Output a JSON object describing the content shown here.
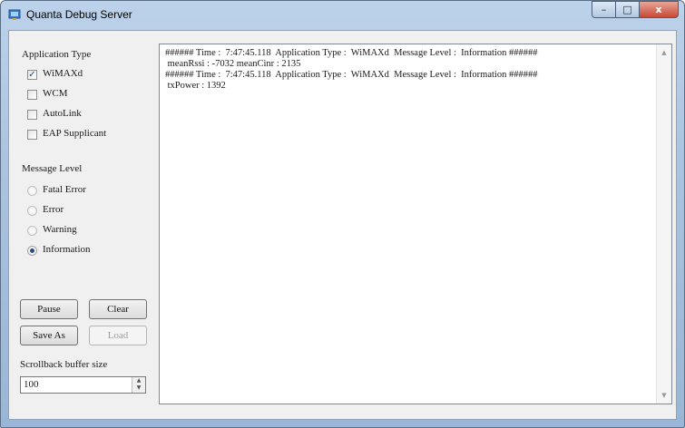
{
  "window": {
    "title": "Quanta Debug Server",
    "icon": "app-icon",
    "controls": {
      "minimize": "–",
      "maximize": "□",
      "close": "x"
    }
  },
  "application_type": {
    "label": "Application Type",
    "options": [
      {
        "label": "WiMAXd",
        "checked": true
      },
      {
        "label": "WCM",
        "checked": false
      },
      {
        "label": "AutoLink",
        "checked": false
      },
      {
        "label": "EAP Supplicant",
        "checked": false
      }
    ]
  },
  "message_level": {
    "label": "Message Level",
    "options": [
      {
        "label": "Fatal Error",
        "selected": false
      },
      {
        "label": "Error",
        "selected": false
      },
      {
        "label": "Warning",
        "selected": false
      },
      {
        "label": "Information",
        "selected": true
      }
    ]
  },
  "buttons": {
    "pause": "Pause",
    "clear": "Clear",
    "save_as": "Save As",
    "load": "Load"
  },
  "scrollback": {
    "label": "Scrollback buffer size",
    "value": "100"
  },
  "log": {
    "lines": [
      "###### Time :  7:47:45.118  Application Type :  WiMAXd  Message Level :  Information ######",
      " meanRssi : -7032 meanCinr : 2135",
      "",
      "###### Time :  7:47:45.118  Application Type :  WiMAXd  Message Level :  Information ######",
      " txPower : 1392"
    ]
  },
  "colors": {
    "titlebar": "#a9c3e0",
    "client_bg": "#f0f0f0",
    "close_button": "#c64a36"
  }
}
